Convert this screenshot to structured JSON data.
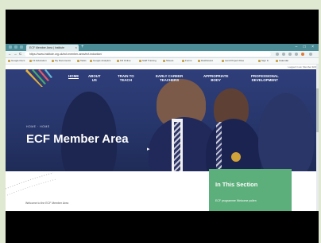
{
  "browser": {
    "tab_title": "ECF Member Area | Institute",
    "tab_close": "×",
    "new_tab": "+",
    "window_controls": "–  □  ×",
    "nav_buttons": {
      "back": "←",
      "forward": "→",
      "reload": "C"
    },
    "url": "https://www.institute.org.uk/ecf-member-area/ecf-induction/",
    "bookmarks": [
      "Google Docs",
      "F1 Education",
      "My Documents",
      "Tasks",
      "Google Analytics",
      "FR Online",
      "Staff Training",
      "Sheets",
      "Forms",
      "Dashboard",
      "Land Project Files",
      "Sign In",
      "Calendar"
    ]
  },
  "site": {
    "account_text": "Logged in as: Member ECF",
    "nav": [
      {
        "label": "HOME",
        "sub": ""
      },
      {
        "label": "ABOUT",
        "sub": "US"
      },
      {
        "label": "TRAIN TO",
        "sub": "TEACH"
      },
      {
        "label": "EARLY CAREER",
        "sub": "TEACHERS"
      },
      {
        "label": "APPROPRIATE",
        "sub": "BODY"
      },
      {
        "label": "PROFESSIONAL",
        "sub": "DEVELOPMENT"
      }
    ],
    "breadcrumb": "HOME  ·  HOME",
    "hero_title": "ECF Member Area",
    "cursor": "▸",
    "welcome": "Welcome to the ECF Member Area",
    "section": {
      "title": "In This Section",
      "text": "ECF programme Welcome pollen"
    }
  },
  "colors": {
    "tabbar": "#4b8c97",
    "hero": "#2f3e7a",
    "section_box": "#5cae7a"
  }
}
